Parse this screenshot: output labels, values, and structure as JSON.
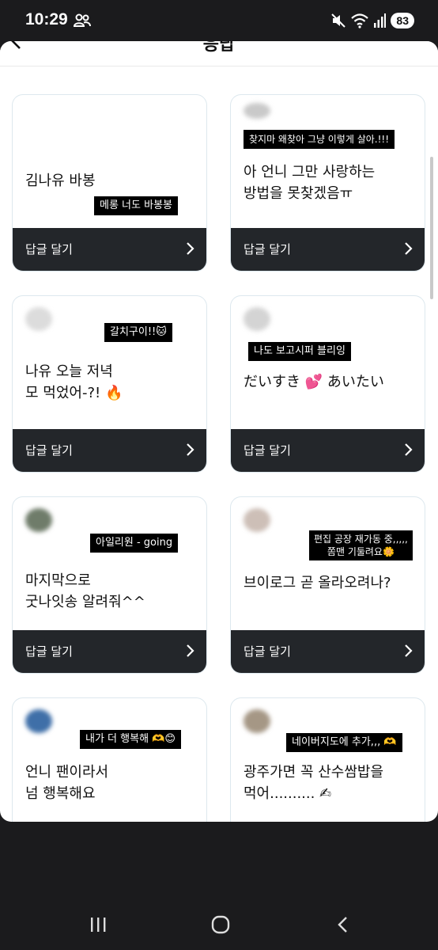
{
  "status_bar": {
    "time": "10:29",
    "battery": "83"
  },
  "header": {
    "title": "응답"
  },
  "cards": [
    {
      "bubble": "메롱 너도 바봉봉",
      "question": "김나유 바봉",
      "reply_label": "답글 달기"
    },
    {
      "bubble": "찾지마 왜찾아 그냥 이렇게 살아.!!!",
      "question": "아 언니 그만 사랑하는\n방법을 못찾겠음ㅠ",
      "reply_label": "답글 달기"
    },
    {
      "bubble": "갈치구이!!🐱",
      "question": "나유 오늘 저녁\n모 먹었어-?! 🔥",
      "reply_label": "답글 달기"
    },
    {
      "bubble": "나도 보고시퍼 블리잉",
      "question": "だいすき 💕 あいたい",
      "reply_label": "답글 달기"
    },
    {
      "bubble": "아일리원 - going",
      "question": "마지막으로\n굿나잇송 알려줘^^",
      "reply_label": "답글 달기"
    },
    {
      "bubble": "편집 공장 재가동 중,,,,,\n쫌맨 기둘려요🌼",
      "question": "브이로그 곧 올라오려나?",
      "reply_label": "답글 달기"
    },
    {
      "bubble": "내가 더 행복해 🫶😊",
      "question": "언니 팬이라서\n넘 행복해요",
      "reply_label": ""
    },
    {
      "bubble": "네이버지도에 추가,,, 🫶",
      "question": "광주가면 꼭 산수쌈밥을\n먹어.......... ✍",
      "reply_label": ""
    }
  ]
}
